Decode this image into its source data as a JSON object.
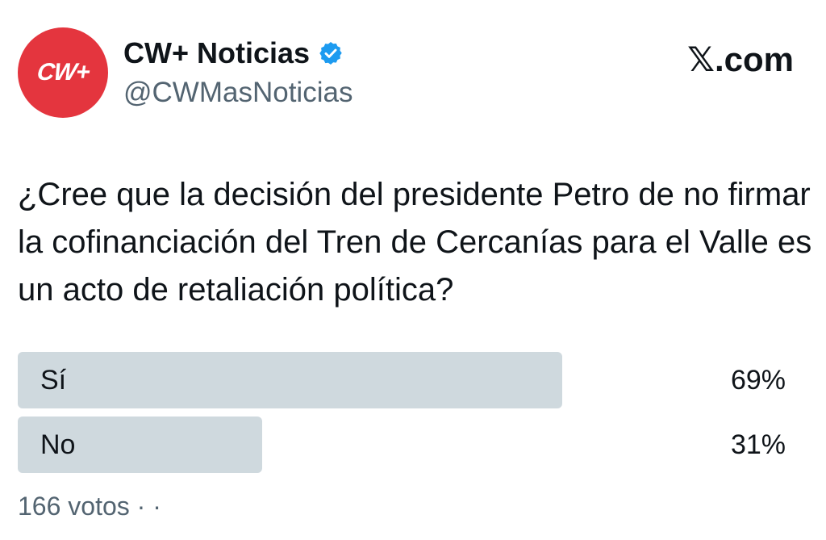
{
  "account": {
    "avatar_text": "CW+",
    "name": "CW+ Noticias",
    "handle": "@CWMasNoticias",
    "verified_icon": "verified-badge-icon"
  },
  "brand": "𝕏.com",
  "question": "¿Cree que la decisión del presidente Petro de no firmar la cofinanciación del Tren de Cercanías para el Valle es un acto de retaliación política?",
  "poll": {
    "options": [
      {
        "label": "Sí",
        "percent": "69%",
        "fraction": 0.69
      },
      {
        "label": "No",
        "percent": "31%",
        "fraction": 0.31
      }
    ],
    "votes": "166 votos · ·"
  },
  "colors": {
    "avatar_bg": "#e4353e",
    "bar": "#cfd9de",
    "verified": "#1d9bf0",
    "secondary_text": "#536471"
  }
}
